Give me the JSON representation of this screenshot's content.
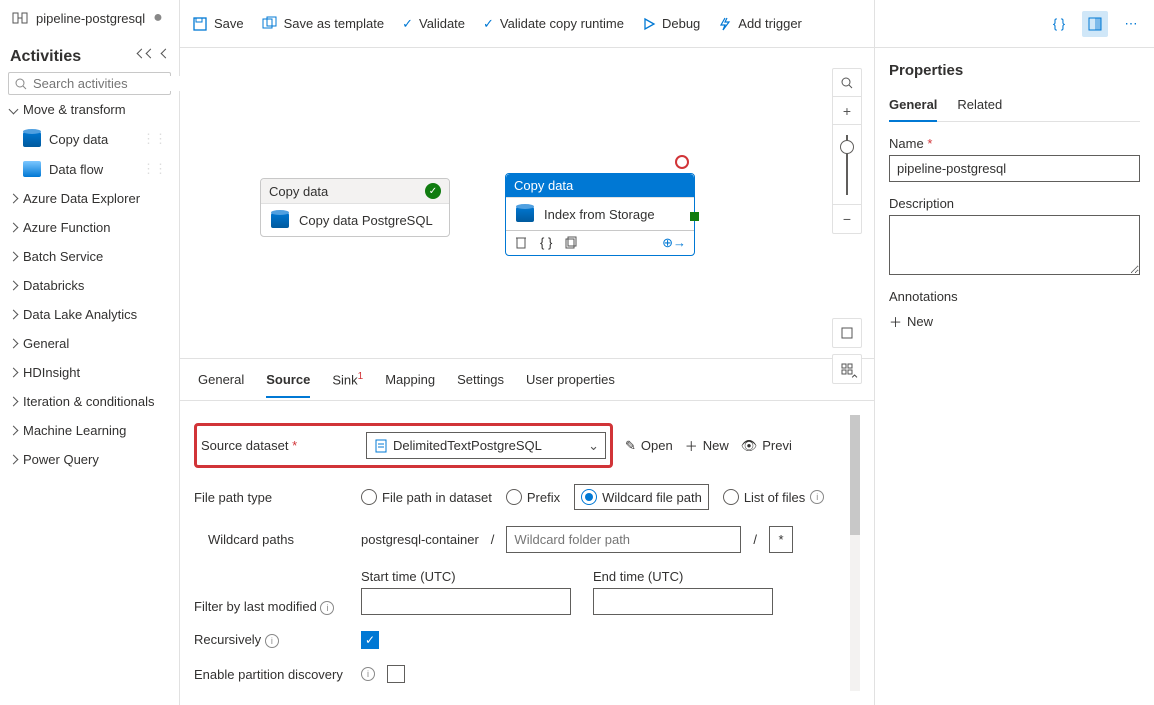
{
  "tab": {
    "title": "pipeline-postgresql"
  },
  "activities": {
    "title": "Activities",
    "search_placeholder": "Search activities",
    "move_transform": "Move & transform",
    "copy_data": "Copy data",
    "data_flow": "Data flow",
    "categories": [
      "Azure Data Explorer",
      "Azure Function",
      "Batch Service",
      "Databricks",
      "Data Lake Analytics",
      "General",
      "HDInsight",
      "Iteration & conditionals",
      "Machine Learning",
      "Power Query"
    ]
  },
  "toolbar": {
    "save": "Save",
    "save_template": "Save as template",
    "validate": "Validate",
    "validate_runtime": "Validate copy runtime",
    "debug": "Debug",
    "add_trigger": "Add trigger"
  },
  "canvas": {
    "node1": {
      "header": "Copy data",
      "label": "Copy data PostgreSQL"
    },
    "node2": {
      "header": "Copy data",
      "label": "Index from Storage"
    }
  },
  "bottom": {
    "tabs": {
      "general": "General",
      "source": "Source",
      "sink": "Sink",
      "mapping": "Mapping",
      "settings": "Settings",
      "user": "User properties"
    },
    "source_dataset_label": "Source dataset",
    "source_dataset_value": "DelimitedTextPostgreSQL",
    "open": "Open",
    "new": "New",
    "preview": "Previ",
    "file_path_type": "File path type",
    "fpt_dataset": "File path in dataset",
    "fpt_prefix": "Prefix",
    "fpt_wildcard": "Wildcard file path",
    "fpt_list": "List of files",
    "wildcard_paths": "Wildcard paths",
    "container": "postgresql-container",
    "slash": "/",
    "folder_ph": "Wildcard folder path",
    "star": "*",
    "start_time": "Start time (UTC)",
    "end_time": "End time (UTC)",
    "filter_label": "Filter by last modified",
    "recursively": "Recursively",
    "enable_partition": "Enable partition discovery"
  },
  "props": {
    "title": "Properties",
    "general": "General",
    "related": "Related",
    "name_label": "Name",
    "name_value": "pipeline-postgresql",
    "desc_label": "Description",
    "ann_label": "Annotations",
    "new": "New"
  }
}
